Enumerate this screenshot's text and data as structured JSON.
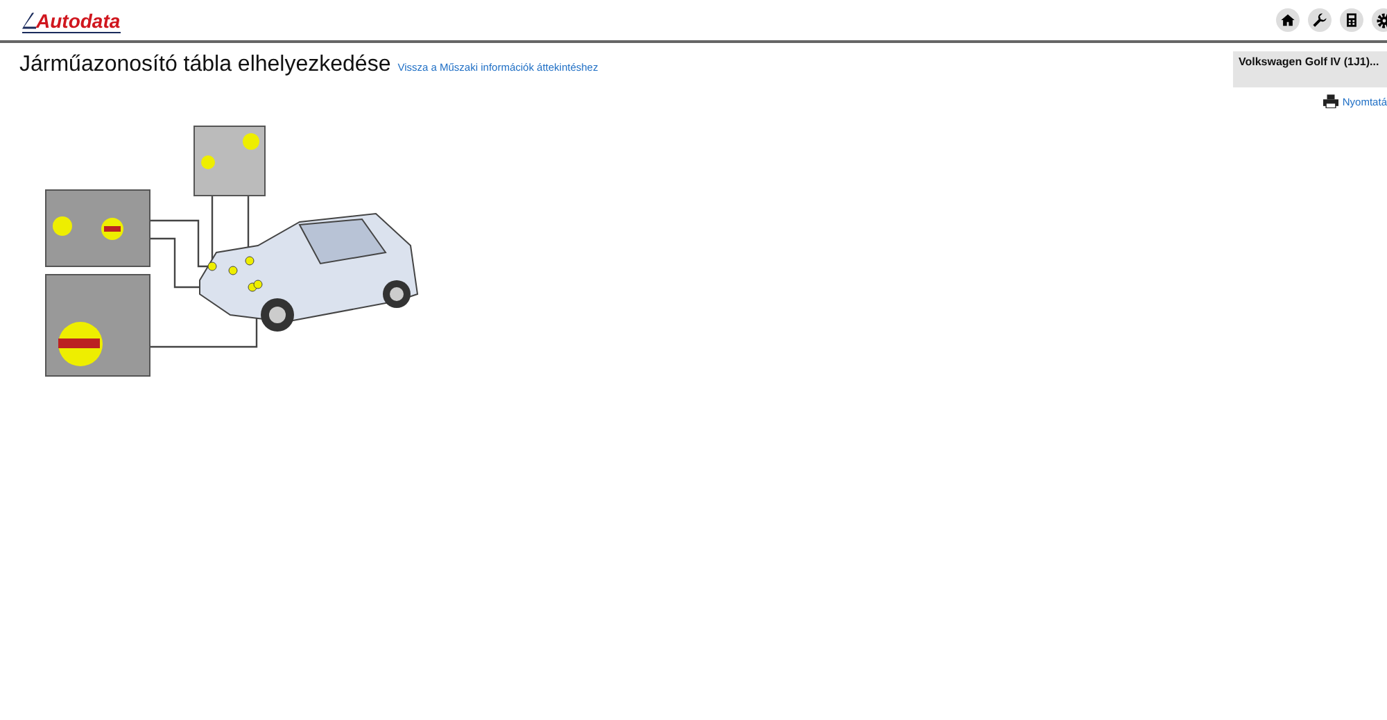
{
  "header": {
    "logo": "Autodata"
  },
  "page": {
    "title": "Járműazonosító tábla elhelyezkedése",
    "back_link": "Vissza a Műszaki információk áttekintéshez"
  },
  "vehicle_panel": {
    "name": "Volkswagen Golf IV (1J1)..."
  },
  "print_link": "Nyomtatá"
}
